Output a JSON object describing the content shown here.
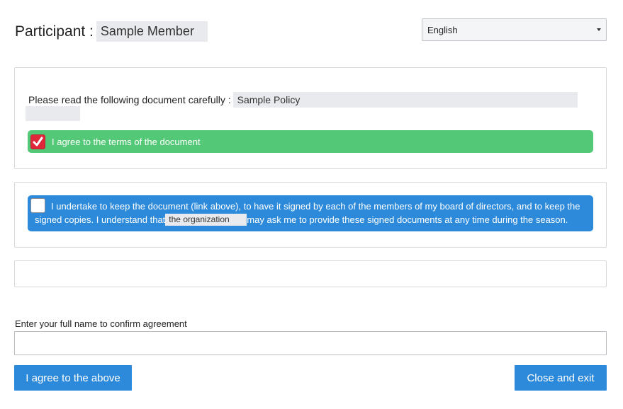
{
  "header": {
    "participant_label": "Participant :",
    "participant_name": "Sample Member"
  },
  "language": {
    "selected": "English"
  },
  "document_panel": {
    "read_label": "Please read the following document carefully :",
    "document_name": "Sample Policy",
    "agree_terms_label": "I agree to the terms of the document",
    "agree_terms_checked": true
  },
  "undertake_panel": {
    "checked": false,
    "line1": "I undertake to keep the document (link above), to have it signed by each of the members of my board of directors, and to keep the",
    "line2_before": "signed copies. I understand that",
    "organization": "the organization",
    "line2_after": "may ask me to provide these signed documents at any time during the season."
  },
  "confirm": {
    "name_label": "Enter your full name to confirm agreement",
    "name_value": "",
    "name_placeholder": ""
  },
  "buttons": {
    "agree": "I agree to the above",
    "close": "Close and exit"
  },
  "colors": {
    "accent_blue": "#2d8adb",
    "success_green": "#53c876",
    "checkbox_red": "#e0283a",
    "chip_gray": "#e9eaed"
  },
  "icons": {
    "checkmark": "checkmark-icon",
    "caret": "chevron-down-icon"
  }
}
